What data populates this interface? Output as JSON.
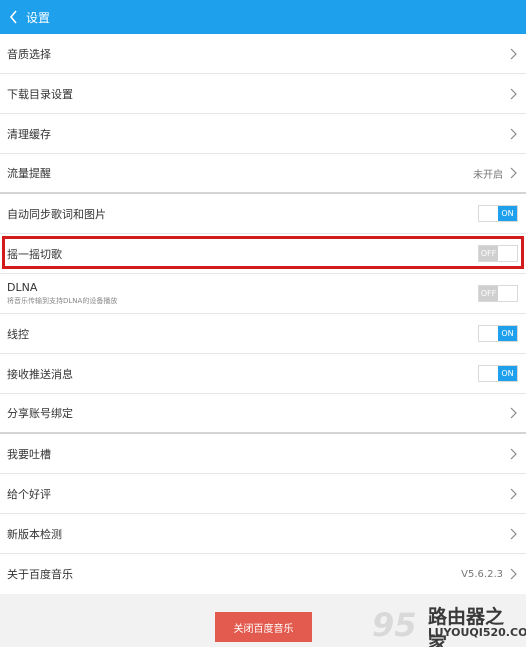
{
  "header": {
    "title": "设置"
  },
  "settings": [
    {
      "label": "音质选择"
    },
    {
      "label": "下载目录设置"
    },
    {
      "label": "清理缓存"
    },
    {
      "label": "流量提醒",
      "value": "未开启"
    },
    {
      "label": "自动同步歌词和图片",
      "toggle": "ON"
    },
    {
      "label": "摇一摇切歌",
      "toggle": "OFF"
    },
    {
      "label": "DLNA",
      "sublabel": "将音乐传输到支持DLNA的设备播放",
      "toggle": "OFF"
    },
    {
      "label": "线控",
      "toggle": "ON"
    },
    {
      "label": "接收推送消息",
      "toggle": "ON"
    },
    {
      "label": "分享账号绑定"
    },
    {
      "label": "我要吐槽"
    },
    {
      "label": "给个好评"
    },
    {
      "label": "新版本检测"
    },
    {
      "label": "关于百度音乐",
      "value": "V5.6.2.3"
    }
  ],
  "footer": {
    "close_label": "关闭百度音乐"
  },
  "watermark": {
    "number": "95",
    "site_cn": "路由器之家",
    "site_en": "LUYOUQI520.COM"
  },
  "colors": {
    "accent": "#1ea0ec",
    "danger": "#e35a4e",
    "highlight": "#d21b1b"
  }
}
